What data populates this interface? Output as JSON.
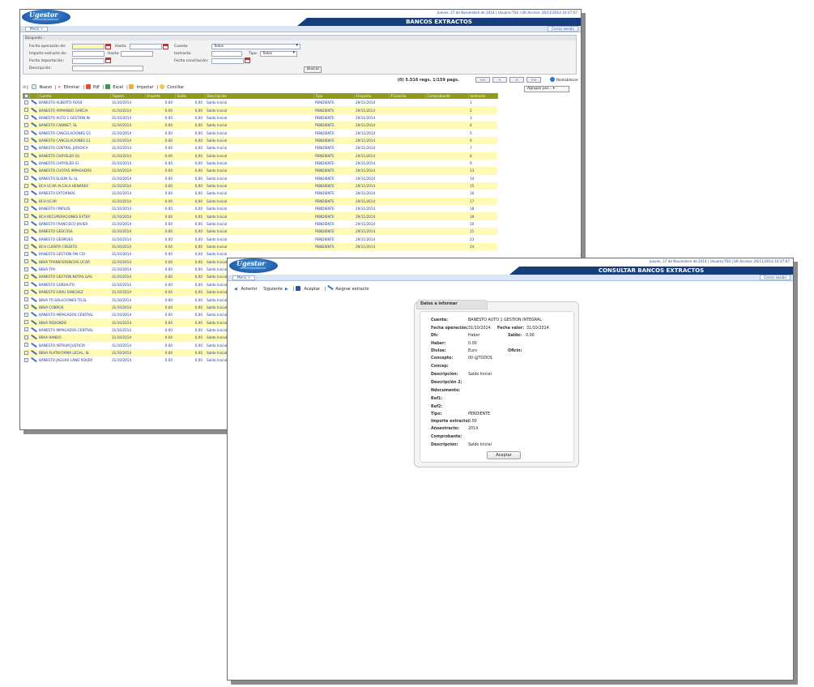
{
  "window_back": {
    "logo": "Ugestor",
    "logo_sub": "ABCDEFGHIJKLMNOPQRS",
    "userinfo": "Jueves, 27 de Noviembre de 2014 | Usuario:TSS | Ult.Acceso: 26/11/2014 10:37:07",
    "title": "BANCOS EXTRACTOS",
    "menu": "Menú >",
    "close": "Cerrar sesión",
    "search": {
      "header": "Búsqueda -",
      "fecha_operacion_de": "Fecha operación de:",
      "hasta": "Hasta:",
      "cuenta": "Cuenta:",
      "cuenta_value": "Todos",
      "importe_de": "Importe extracto de:",
      "hasta2": "Hasta:",
      "iextracto": "Iextracto:",
      "tipo": "Tipo:",
      "tipo_value": "Todos",
      "fecha_importacion": "Fecha importación:",
      "fecha_conciliacion": "Fecha conciliación:",
      "descripcion": "Descripción:",
      "buscar": "Buscar"
    },
    "records": "(0) 5.516 regs. 1/159 pags.",
    "pager": [
      "<<",
      "<",
      ">",
      ">>"
    ],
    "restablecer": "Restablecer",
    "agrupar": "Agrupar por...",
    "toolbar": {
      "nuevo": "Nuevo",
      "eliminar": "Eliminar",
      "pdf": "Pdf",
      "excel": "Excel",
      "importar": "Importar",
      "conciliar": "Conciliar"
    },
    "columns": [
      "Cuenta",
      "Fopera",
      "Importe",
      "Saldo",
      "Descripción",
      "Tipo",
      "FImporta",
      "FConcilia",
      "Comprobante",
      "Iextracto"
    ],
    "rows": [
      [
        "BANESTO ALBERTO ROSS",
        "31/10/2014",
        "0.00",
        "0,00",
        "Saldo Inicial",
        "PENDIENTE",
        "29/11/2014",
        "",
        "",
        "1"
      ],
      [
        "BANESTO ARMANDO GARCIA",
        "31/10/2014",
        "0.00",
        "0,00",
        "Saldo Inicial",
        "PENDIENTE",
        "29/11/2014",
        "",
        "",
        "2"
      ],
      [
        "BANESTO AUTO 1 GESTION IN",
        "31/10/2014",
        "0.00",
        "0,00",
        "Saldo Inicial",
        "PENDIENTE",
        "29/11/2014",
        "",
        "",
        "3"
      ],
      [
        "BANESTO CABINET, SL",
        "31/10/2014",
        "0.00",
        "0,00",
        "Saldo Inicial",
        "PENDIENTE",
        "29/11/2014",
        "",
        "",
        "4"
      ],
      [
        "BANESTO CANCELACIONES Q1",
        "31/10/2014",
        "0.00",
        "0,00",
        "Saldo Inicial",
        "PENDIENTE",
        "29/11/2014",
        "",
        "",
        "5"
      ],
      [
        "BANESTO CANCELACIONES S1",
        "31/10/2014",
        "0.00",
        "0,00",
        "Saldo Inicial",
        "PENDIENTE",
        "29/11/2014",
        "",
        "",
        "6"
      ],
      [
        "BANESTO CENTRAL JURIDICA",
        "31/10/2014",
        "0.00",
        "0,00",
        "Saldo Inicial",
        "PENDIENTE",
        "29/11/2014",
        "",
        "",
        "7"
      ],
      [
        "BANESTO CHRYSLER Q1",
        "31/10/2014",
        "0.00",
        "0,00",
        "Saldo Inicial",
        "PENDIENTE",
        "29/11/2014",
        "",
        "",
        "8"
      ],
      [
        "BANESTO CHRYSLER S1",
        "31/10/2014",
        "0.00",
        "0,00",
        "Saldo Inicial",
        "PENDIENTE",
        "29/11/2014",
        "",
        "",
        "9"
      ],
      [
        "BANESTO CUOTAS IMPAGADOS",
        "31/10/2014",
        "0.00",
        "0,00",
        "Saldo Inicial",
        "PENDIENTE",
        "29/11/2014",
        "",
        "",
        "13"
      ],
      [
        "BANESTO ELSON SL SL",
        "31/10/2014",
        "0.00",
        "0,00",
        "Saldo Inicial",
        "PENDIENTE",
        "29/11/2014",
        "",
        "",
        "14"
      ],
      [
        "BCH UCAR ALCALA HENARES",
        "31/10/2014",
        "0.00",
        "0,00",
        "Saldo Inicial",
        "PENDIENTE",
        "29/11/2014",
        "",
        "",
        "15"
      ],
      [
        "BANESTO EXTORNOS",
        "31/10/2014",
        "0.00",
        "0,00",
        "Saldo Inicial",
        "PENDIENTE",
        "29/11/2014",
        "",
        "",
        "16"
      ],
      [
        "BCH UCAR",
        "31/10/2014",
        "0.00",
        "0,00",
        "Saldo Inicial",
        "PENDIENTE",
        "29/11/2014",
        "",
        "",
        "17"
      ],
      [
        "BANESTO FINPLUS",
        "31/10/2014",
        "0.00",
        "0,00",
        "Saldo Inicial",
        "PENDIENTE",
        "29/11/2014",
        "",
        "",
        "18"
      ],
      [
        "BCH RECUPERACIONES EXTER",
        "31/10/2014",
        "0.00",
        "0,00",
        "Saldo Inicial",
        "PENDIENTE",
        "29/11/2014",
        "",
        "",
        "19"
      ],
      [
        "BANESTO FRANCISCO JAVIER",
        "31/10/2014",
        "0.00",
        "0,00",
        "Saldo Inicial",
        "PENDIENTE",
        "29/11/2014",
        "",
        "",
        "20"
      ],
      [
        "BANESTO GESCOSA",
        "31/10/2014",
        "0.00",
        "0,00",
        "Saldo Inicial",
        "PENDIENTE",
        "29/11/2014",
        "",
        "",
        "21"
      ],
      [
        "BANESTO GESMOES",
        "31/10/2014",
        "0.00",
        "0,00",
        "Saldo Inicial",
        "PENDIENTE",
        "29/11/2014",
        "",
        "",
        "23"
      ],
      [
        "BCH CUENTA CREDITO",
        "31/10/2014",
        "0.00",
        "0,00",
        "Saldo Inicial",
        "PENDIENTE",
        "29/11/2014",
        "",
        "",
        "24"
      ],
      [
        "BANESTO GESTION FIN CDI",
        "31/10/2014",
        "0.00",
        "0,00",
        "Saldo Inicial",
        "",
        "",
        "",
        "",
        ""
      ],
      [
        "BBVA TRANSFERENCIAS UCAR",
        "31/10/2014",
        "0.00",
        "0,00",
        "Saldo Inicial",
        "",
        "",
        "",
        "",
        ""
      ],
      [
        "BBVA TPV",
        "31/10/2014",
        "0.00",
        "0,00",
        "Saldo Inicial",
        "",
        "",
        "",
        "",
        ""
      ],
      [
        "BANESTO GESTION NOTAS GAS",
        "31/10/2014",
        "0.00",
        "0,00",
        "Saldo Inicial",
        "",
        "",
        "",
        "",
        ""
      ],
      [
        "BANESTO GOIDAUTO",
        "31/10/2014",
        "0.00",
        "0,00",
        "Saldo Inicial",
        "",
        "",
        "",
        "",
        ""
      ],
      [
        "BANESTO GRAU SANCHEZ",
        "31/10/2014",
        "0.00",
        "0,00",
        "Saldo Inicial",
        "",
        "",
        "",
        "",
        ""
      ],
      [
        "BBVA TR SOLUCIONES TR,SL",
        "31/10/2014",
        "0.00",
        "0,00",
        "Saldo Inicial",
        "",
        "",
        "",
        "",
        ""
      ],
      [
        "BBVA COBROS",
        "31/10/2014",
        "0.00",
        "0,00",
        "Saldo Inicial",
        "",
        "",
        "",
        "",
        ""
      ],
      [
        "BANESTO IMPAGADOS CENTRAL",
        "31/10/2014",
        "0.00",
        "0,00",
        "Saldo Inicial",
        "",
        "",
        "",
        "",
        ""
      ],
      [
        "BBVA REDONDO",
        "31/10/2014",
        "0.00",
        "0,00",
        "Saldo Inicial",
        "",
        "",
        "",
        "",
        ""
      ],
      [
        "BANESTO IMPAGADOS CENTRAL",
        "31/10/2014",
        "0.00",
        "0,00",
        "Saldo Inicial",
        "",
        "",
        "",
        "",
        ""
      ],
      [
        "BBVA RANDO",
        "31/10/2014",
        "0.00",
        "0,00",
        "Saldo Inicial",
        "",
        "",
        "",
        "",
        ""
      ],
      [
        "BANESTO INTRUM JUSTICIA",
        "31/10/2014",
        "0.00",
        "0,00",
        "Saldo Inicial",
        "",
        "",
        "",
        "",
        ""
      ],
      [
        "BBVA PLATAFORMA LEGAL, SL",
        "31/10/2014",
        "0.00",
        "0,00",
        "Saldo Inicial",
        "",
        "",
        "",
        "",
        ""
      ],
      [
        "BANESTO JAGUAR LAND ROVER",
        "31/10/2014",
        "0.00",
        "0,00",
        "Saldo Inicial",
        "",
        "",
        "",
        "",
        ""
      ]
    ]
  },
  "window_front": {
    "logo": "Ugestor",
    "logo_sub": "ABCDEFGHIJKLMNOPQRS",
    "userinfo": "Jueves, 27 de Noviembre de 2014 | Usuario:TSS | Ult.Acceso: 26/11/2014 10:37:07",
    "title": "CONSULTAR BANCOS EXTRACTOS",
    "menu": "Menú >",
    "close": "Cerrar sesión",
    "toolbar": {
      "anterior": "Anterior",
      "siguiente": "Siguiente",
      "aceptar": "Aceptar",
      "asignar": "Asignar extracto"
    },
    "card_title": "Datos a informar",
    "fields": {
      "cuenta_l": "Cuenta:",
      "cuenta_v": "BANESTO AUTO 1 GESTION INTEGRAL",
      "fop_l": "Fecha operación:",
      "fop_v": "31/10/2014",
      "fval_l": "Fecha valor:",
      "fval_v": "31/10/2014",
      "dh_l": "Dh:",
      "dh_v": "Haber",
      "saldo_l": "Saldo:",
      "saldo_v": "0.00",
      "haber_l": "Haber:",
      "haber_v": "0.00",
      "divisa_l": "Divisa:",
      "divisa_v": "Euro",
      "oficin_l": "Oficin:",
      "concepto_l": "Concepto:",
      "concepto_v": "00-@TODOS",
      "concep_l": "Concep:",
      "desc_l": "Descripción:",
      "desc_v": "Saldo Inicial",
      "desc2_l": "Descripción 2:",
      "ndoc_l": "Ndocumento:",
      "ref1_l": "Ref1:",
      "ref2_l": "Ref2:",
      "tipo_l": "Tipo:",
      "tipo_v": "PENDIENTE",
      "imp_l": "Importe extracto:",
      "imp_v": "0.00",
      "anio_l": "Añoextracto:",
      "anio_v": "2014",
      "comp_l": "Comprobante:",
      "desc3_l": "Descripción:",
      "desc3_v": "Saldo Inicial"
    },
    "ok": "Aceptar"
  }
}
